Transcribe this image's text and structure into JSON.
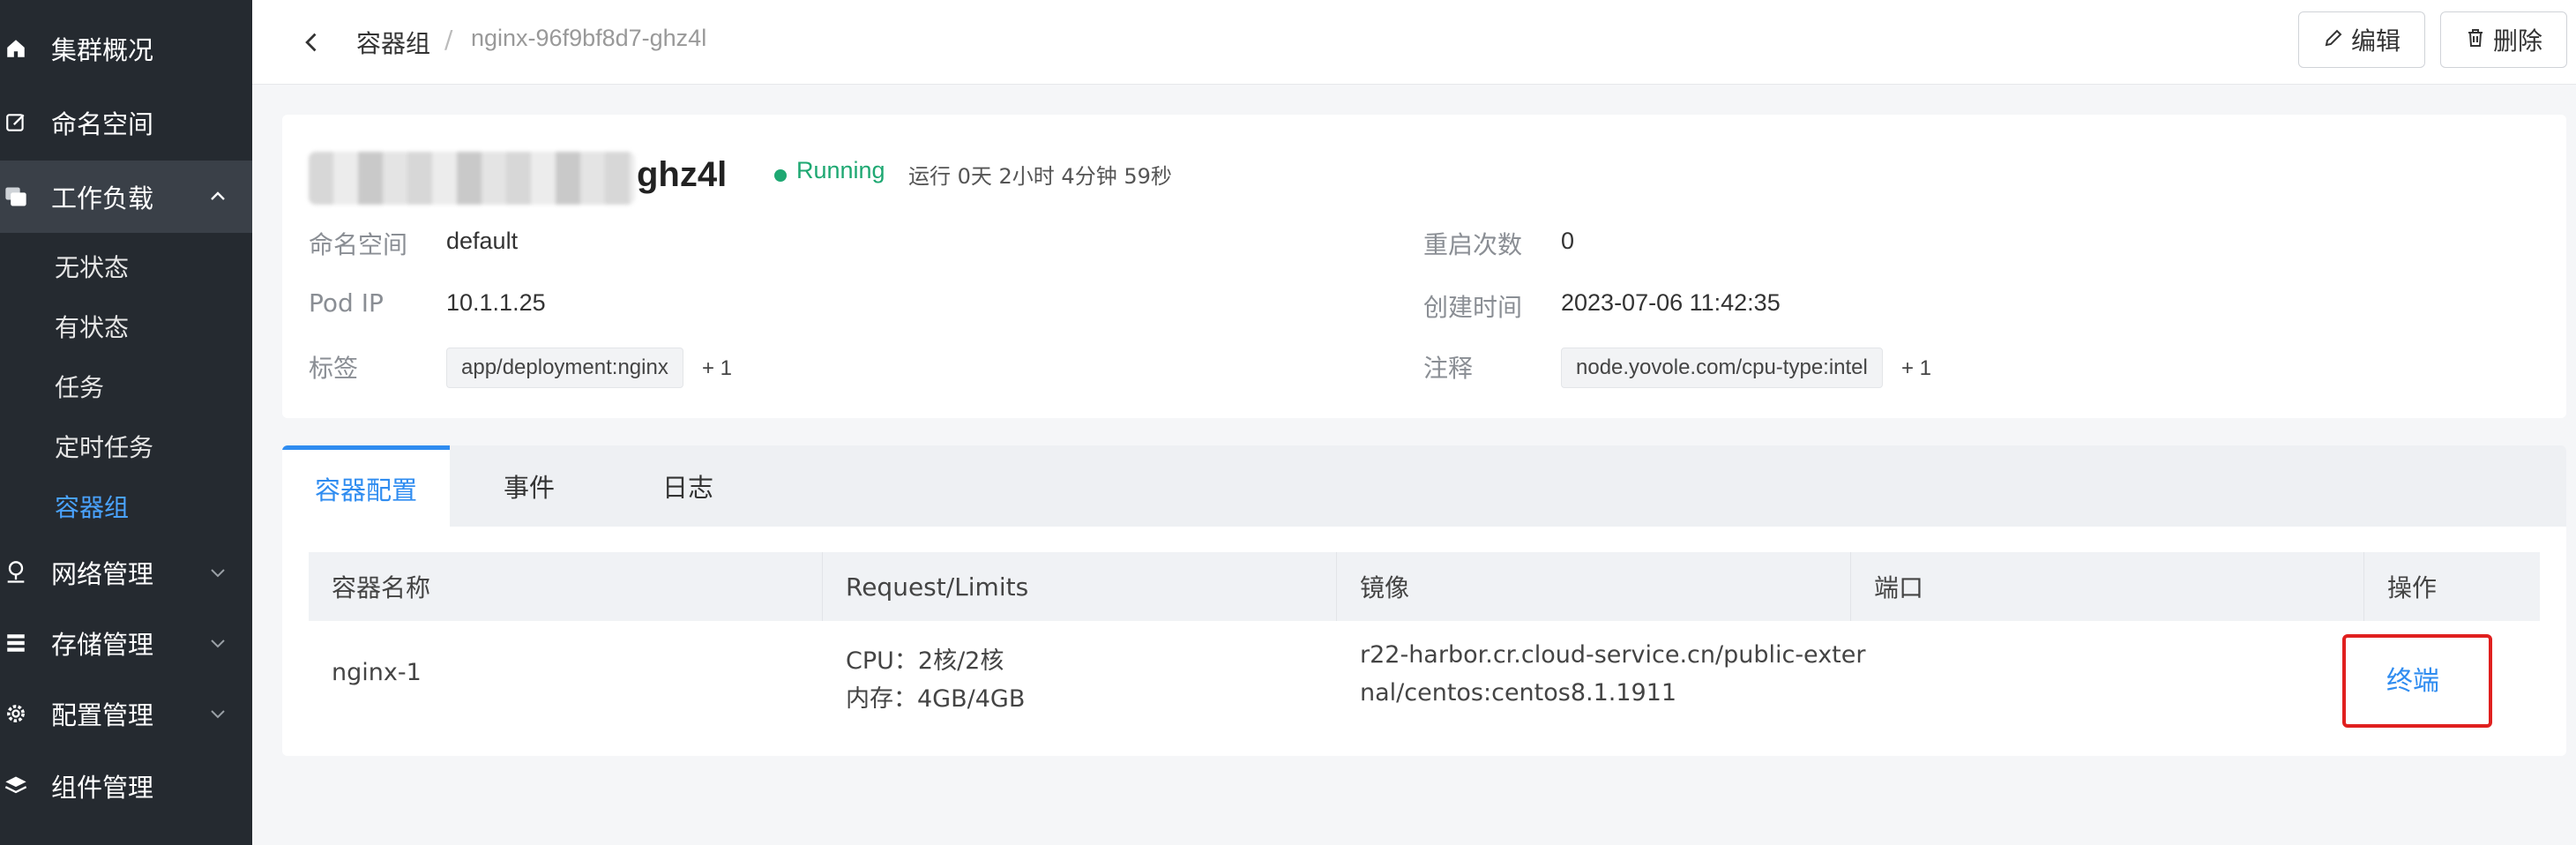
{
  "sidebar": {
    "items": [
      {
        "label": "集群概况",
        "icon": "home-icon"
      },
      {
        "label": "命名空间",
        "icon": "edit-square-icon"
      },
      {
        "label": "工作负载",
        "icon": "stack-icon",
        "expanded": true
      },
      {
        "label": "网络管理",
        "icon": "network-icon"
      },
      {
        "label": "存储管理",
        "icon": "storage-icon"
      },
      {
        "label": "配置管理",
        "icon": "gear-icon"
      },
      {
        "label": "组件管理",
        "icon": "layers-icon"
      }
    ],
    "workload_subitems": [
      "无状态",
      "有状态",
      "任务",
      "定时任务",
      "容器组"
    ],
    "active_subitem": "容器组"
  },
  "header": {
    "breadcrumb_parent": "容器组",
    "breadcrumb_separator": "/",
    "breadcrumb_current": "nginx-96f9bf8d7-ghz4l",
    "edit_label": "编辑",
    "delete_label": "删除"
  },
  "pod": {
    "name_visible_suffix": "ghz4l",
    "status": "Running",
    "uptime": "运行 0天 2小时 4分钟 59秒",
    "fields": {
      "namespace_label": "命名空间",
      "namespace_value": "default",
      "pod_ip_label": "Pod IP",
      "pod_ip_value": "10.1.1.25",
      "labels_label": "标签",
      "label_tag": "app/deployment:nginx",
      "label_more": "+ 1",
      "restarts_label": "重启次数",
      "restarts_value": "0",
      "created_label": "创建时间",
      "created_value": "2023-07-06 11:42:35",
      "annotations_label": "注释",
      "annotation_tag": "node.yovole.com/cpu-type:intel",
      "annotation_more": "+ 1"
    }
  },
  "tabs": [
    {
      "label": "容器配置",
      "active": true
    },
    {
      "label": "事件",
      "active": false
    },
    {
      "label": "日志",
      "active": false
    }
  ],
  "table": {
    "columns": [
      "容器名称",
      "Request/Limits",
      "镜像",
      "端口",
      "操作"
    ],
    "rows": [
      {
        "name": "nginx-1",
        "cpu": "CPU：2核/2核",
        "memory": "内存：4GB/4GB",
        "image_line1": "r22-harbor.cr.cloud-service.cn/public-exter",
        "image_line2": "nal/centos:centos8.1.1911",
        "port": "",
        "action": "终端"
      }
    ]
  },
  "colors": {
    "sidebar_bg": "#252a30",
    "accent": "#2f8cf0",
    "running": "#1ea872",
    "highlight_box": "#e0201f"
  }
}
